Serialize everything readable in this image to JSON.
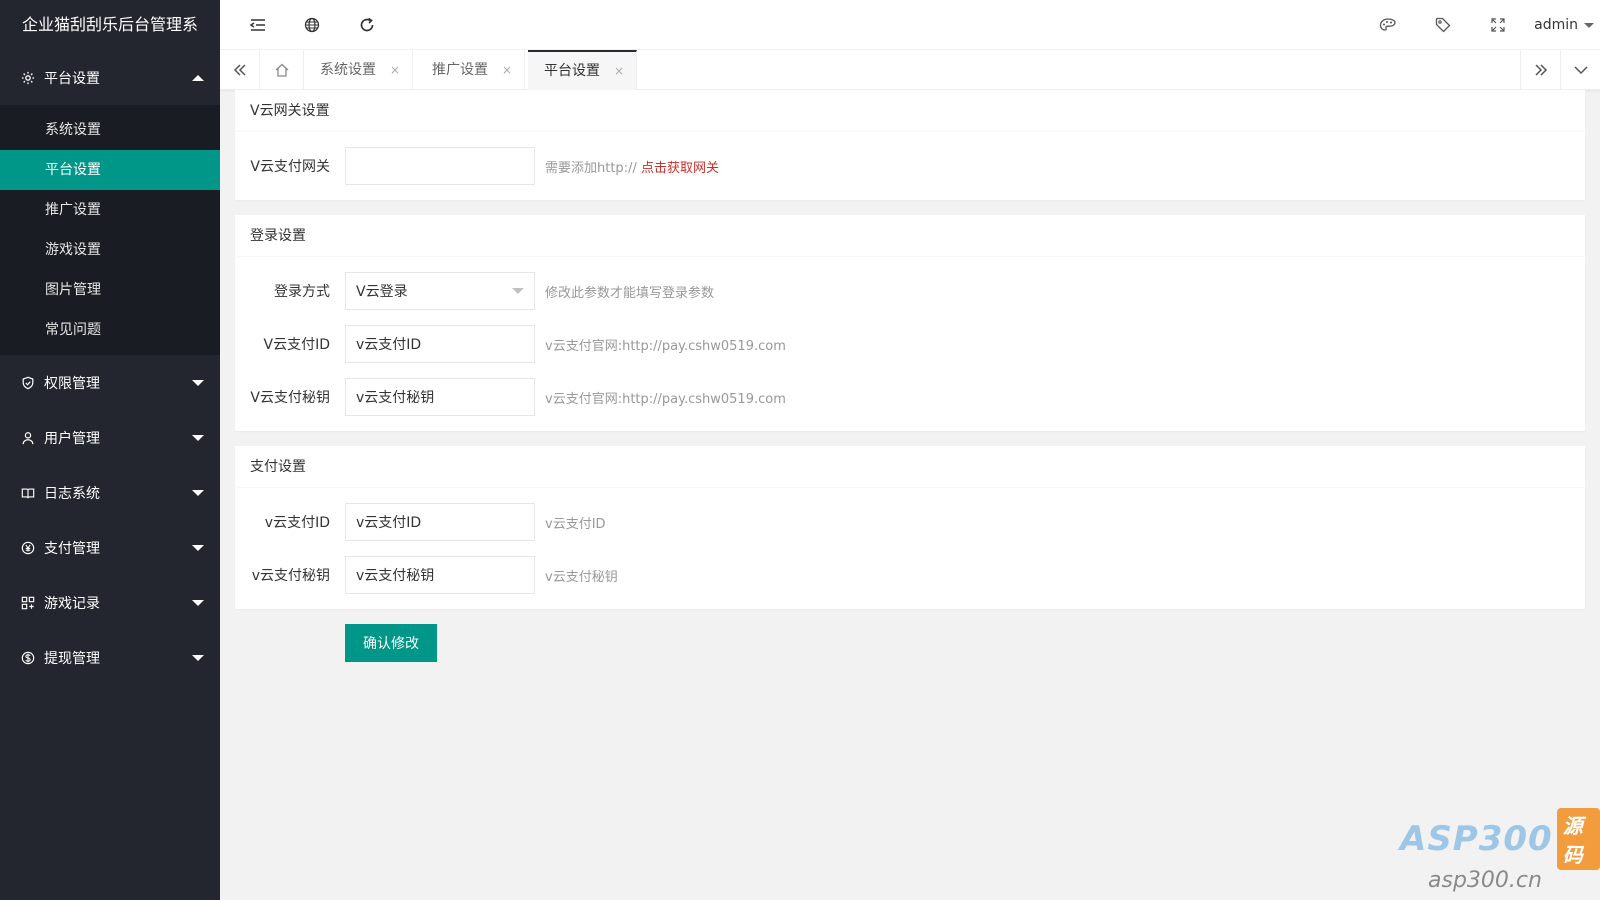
{
  "app": {
    "title": "企业猫刮刮乐后台管理系"
  },
  "sidebar": {
    "open_group": {
      "label": "平台设置",
      "icon": "gear-icon",
      "items": [
        {
          "label": "系统设置",
          "active": false
        },
        {
          "label": "平台设置",
          "active": true
        },
        {
          "label": "推广设置",
          "active": false
        },
        {
          "label": "游戏设置",
          "active": false
        },
        {
          "label": "图片管理",
          "active": false
        },
        {
          "label": "常见问题",
          "active": false
        }
      ]
    },
    "groups": [
      {
        "label": "权限管理",
        "icon": "shield-icon"
      },
      {
        "label": "用户管理",
        "icon": "user-icon"
      },
      {
        "label": "日志系统",
        "icon": "book-icon"
      },
      {
        "label": "支付管理",
        "icon": "yen-icon"
      },
      {
        "label": "游戏记录",
        "icon": "grid-icon"
      },
      {
        "label": "提现管理",
        "icon": "dollar-icon"
      }
    ]
  },
  "header": {
    "user": "admin",
    "icons": [
      "menu-fold-icon",
      "globe-icon",
      "refresh-icon",
      "theme-icon",
      "tag-icon",
      "fullscreen-icon"
    ]
  },
  "tabs": {
    "items": [
      {
        "label": "系统设置",
        "active": false
      },
      {
        "label": "推广设置",
        "active": false
      },
      {
        "label": "平台设置",
        "active": true
      }
    ],
    "close_glyph": "×"
  },
  "sections": {
    "gateway": {
      "title": "V云网关设置",
      "field_label": "V云支付网关",
      "field_value": "",
      "tip_prefix": "需要添加http://",
      "tip_link": "点击获取网关"
    },
    "login": {
      "title": "登录设置",
      "method_label": "登录方式",
      "method_value": "V云登录",
      "method_tip": "修改此参数才能填写登录参数",
      "id_label": "V云支付ID",
      "id_value": "v云支付ID",
      "id_tip": "v云支付官网:http://pay.cshw0519.com",
      "key_label": "V云支付秘钥",
      "key_value": "v云支付秘钥",
      "key_tip": "v云支付官网:http://pay.cshw0519.com"
    },
    "pay": {
      "title": "支付设置",
      "id_label": "v云支付ID",
      "id_value": "v云支付ID",
      "id_tip": "v云支付ID",
      "key_label": "v云支付秘钥",
      "key_value": "v云支付秘钥",
      "key_tip": "v云支付秘钥"
    }
  },
  "submit_label": "确认修改",
  "watermark": {
    "brand": "ASP300",
    "badge": "源码",
    "url": "asp300.cn"
  },
  "colors": {
    "sidebar_bg": "#23262e",
    "submenu_bg": "#191c22",
    "accent": "#009688",
    "link_red": "#c9302c"
  }
}
